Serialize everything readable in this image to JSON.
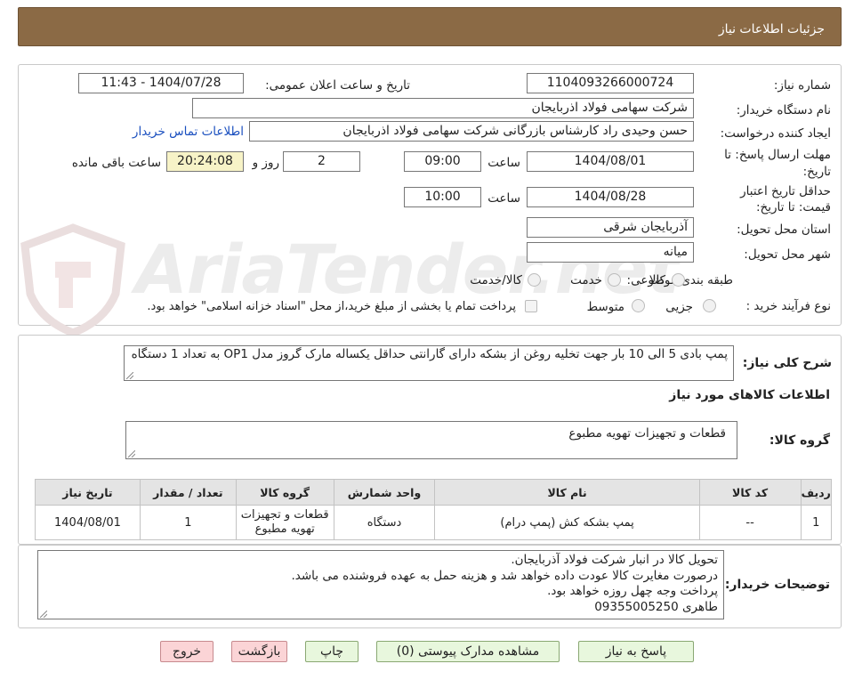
{
  "header": {
    "title": "جزئیات اطلاعات نیاز"
  },
  "watermark": {
    "text": "AriaTender.net"
  },
  "form": {
    "need_number_label": "شماره نیاز:",
    "need_number": "1104093266000724",
    "announce_label": "تاریخ و ساعت اعلان عمومی:",
    "announce_value": "1404/07/28 - 11:43",
    "buyer_label": "نام دستگاه خریدار:",
    "buyer_value": "شرکت سهامی فولاد اذربایجان",
    "creator_label": "ایجاد کننده درخواست:",
    "creator_value": "حسن وحیدی راد کارشناس بازرگانی شرکت سهامی فولاد اذربایجان",
    "contact_link": "اطلاعات تماس خریدار",
    "deadline_label_1": "مهلت ارسال پاسخ: تا",
    "deadline_label_2": "تاریخ:",
    "deadline_date": "1404/08/01",
    "time_label": "ساعت",
    "deadline_time": "09:00",
    "days_value": "2",
    "days_label": "روز و",
    "remaining_time": "20:24:08",
    "remaining_label": "ساعت باقی مانده",
    "validity_label_1": "حداقل تاریخ اعتبار",
    "validity_label_2": "قیمت: تا تاریخ:",
    "validity_date": "1404/08/28",
    "validity_time": "10:00",
    "province_label": "استان محل تحویل:",
    "province_value": "آذربایجان شرقی",
    "city_label": "شهر محل تحویل:",
    "city_value": "میانه",
    "category_label": "طبقه بندی موضوعی:",
    "category_options": [
      "کالا",
      "خدمت",
      "کالا/خدمت"
    ],
    "process_label": "نوع فرآیند خرید :",
    "process_options": [
      "جزیی",
      "متوسط"
    ],
    "payment_note": "پرداخت تمام یا بخشی از مبلغ خرید،از محل \"اسناد خزانه اسلامی\" خواهد بود."
  },
  "description": {
    "label": "شرح کلی نیاز:",
    "text": "پمپ بادی 5 الی 10 بار جهت تخلیه روغن از بشکه دارای گارانتی حداقل یکساله مارک گروز مدل OP1 به تعداد 1 دستگاه"
  },
  "goods_section": {
    "title": "اطلاعات کالاهای مورد نیاز",
    "group_label": "گروه کالا:",
    "group_value": "قطعات و تجهیزات تهویه مطبوع"
  },
  "table": {
    "headers": [
      "ردیف",
      "کد کالا",
      "نام کالا",
      "واحد شمارش",
      "گروه کالا",
      "تعداد / مقدار",
      "تاریخ نیاز"
    ],
    "rows": [
      [
        "1",
        "--",
        "پمپ بشکه کش (پمپ درام)",
        "دستگاه",
        "قطعات و تجهیزات تهویه مطبوع",
        "1",
        "1404/08/01"
      ]
    ]
  },
  "buyer_notes": {
    "label": "توضیحات خریدار:",
    "lines": [
      "تحویل کالا در انبار شرکت فولاد آذربایجان.",
      "درصورت مغایرت کالا عودت داده خواهد شد و هزینه حمل به عهده فروشنده می باشد.",
      "پرداخت وجه چهل روزه خواهد بود.",
      "طاهری 09355005250"
    ]
  },
  "buttons": {
    "reply": "پاسخ به نیاز",
    "attachments": "مشاهده مدارک پیوستی (0)",
    "print": "چاپ",
    "back": "بازگشت",
    "exit": "خروج"
  },
  "colors": {
    "header_bg": "#8b6a45",
    "button_green": "#e8f7dd",
    "button_pink": "#fbd4d6",
    "link": "#1a4fbf",
    "remaining_bg": "#f7f3c7"
  }
}
